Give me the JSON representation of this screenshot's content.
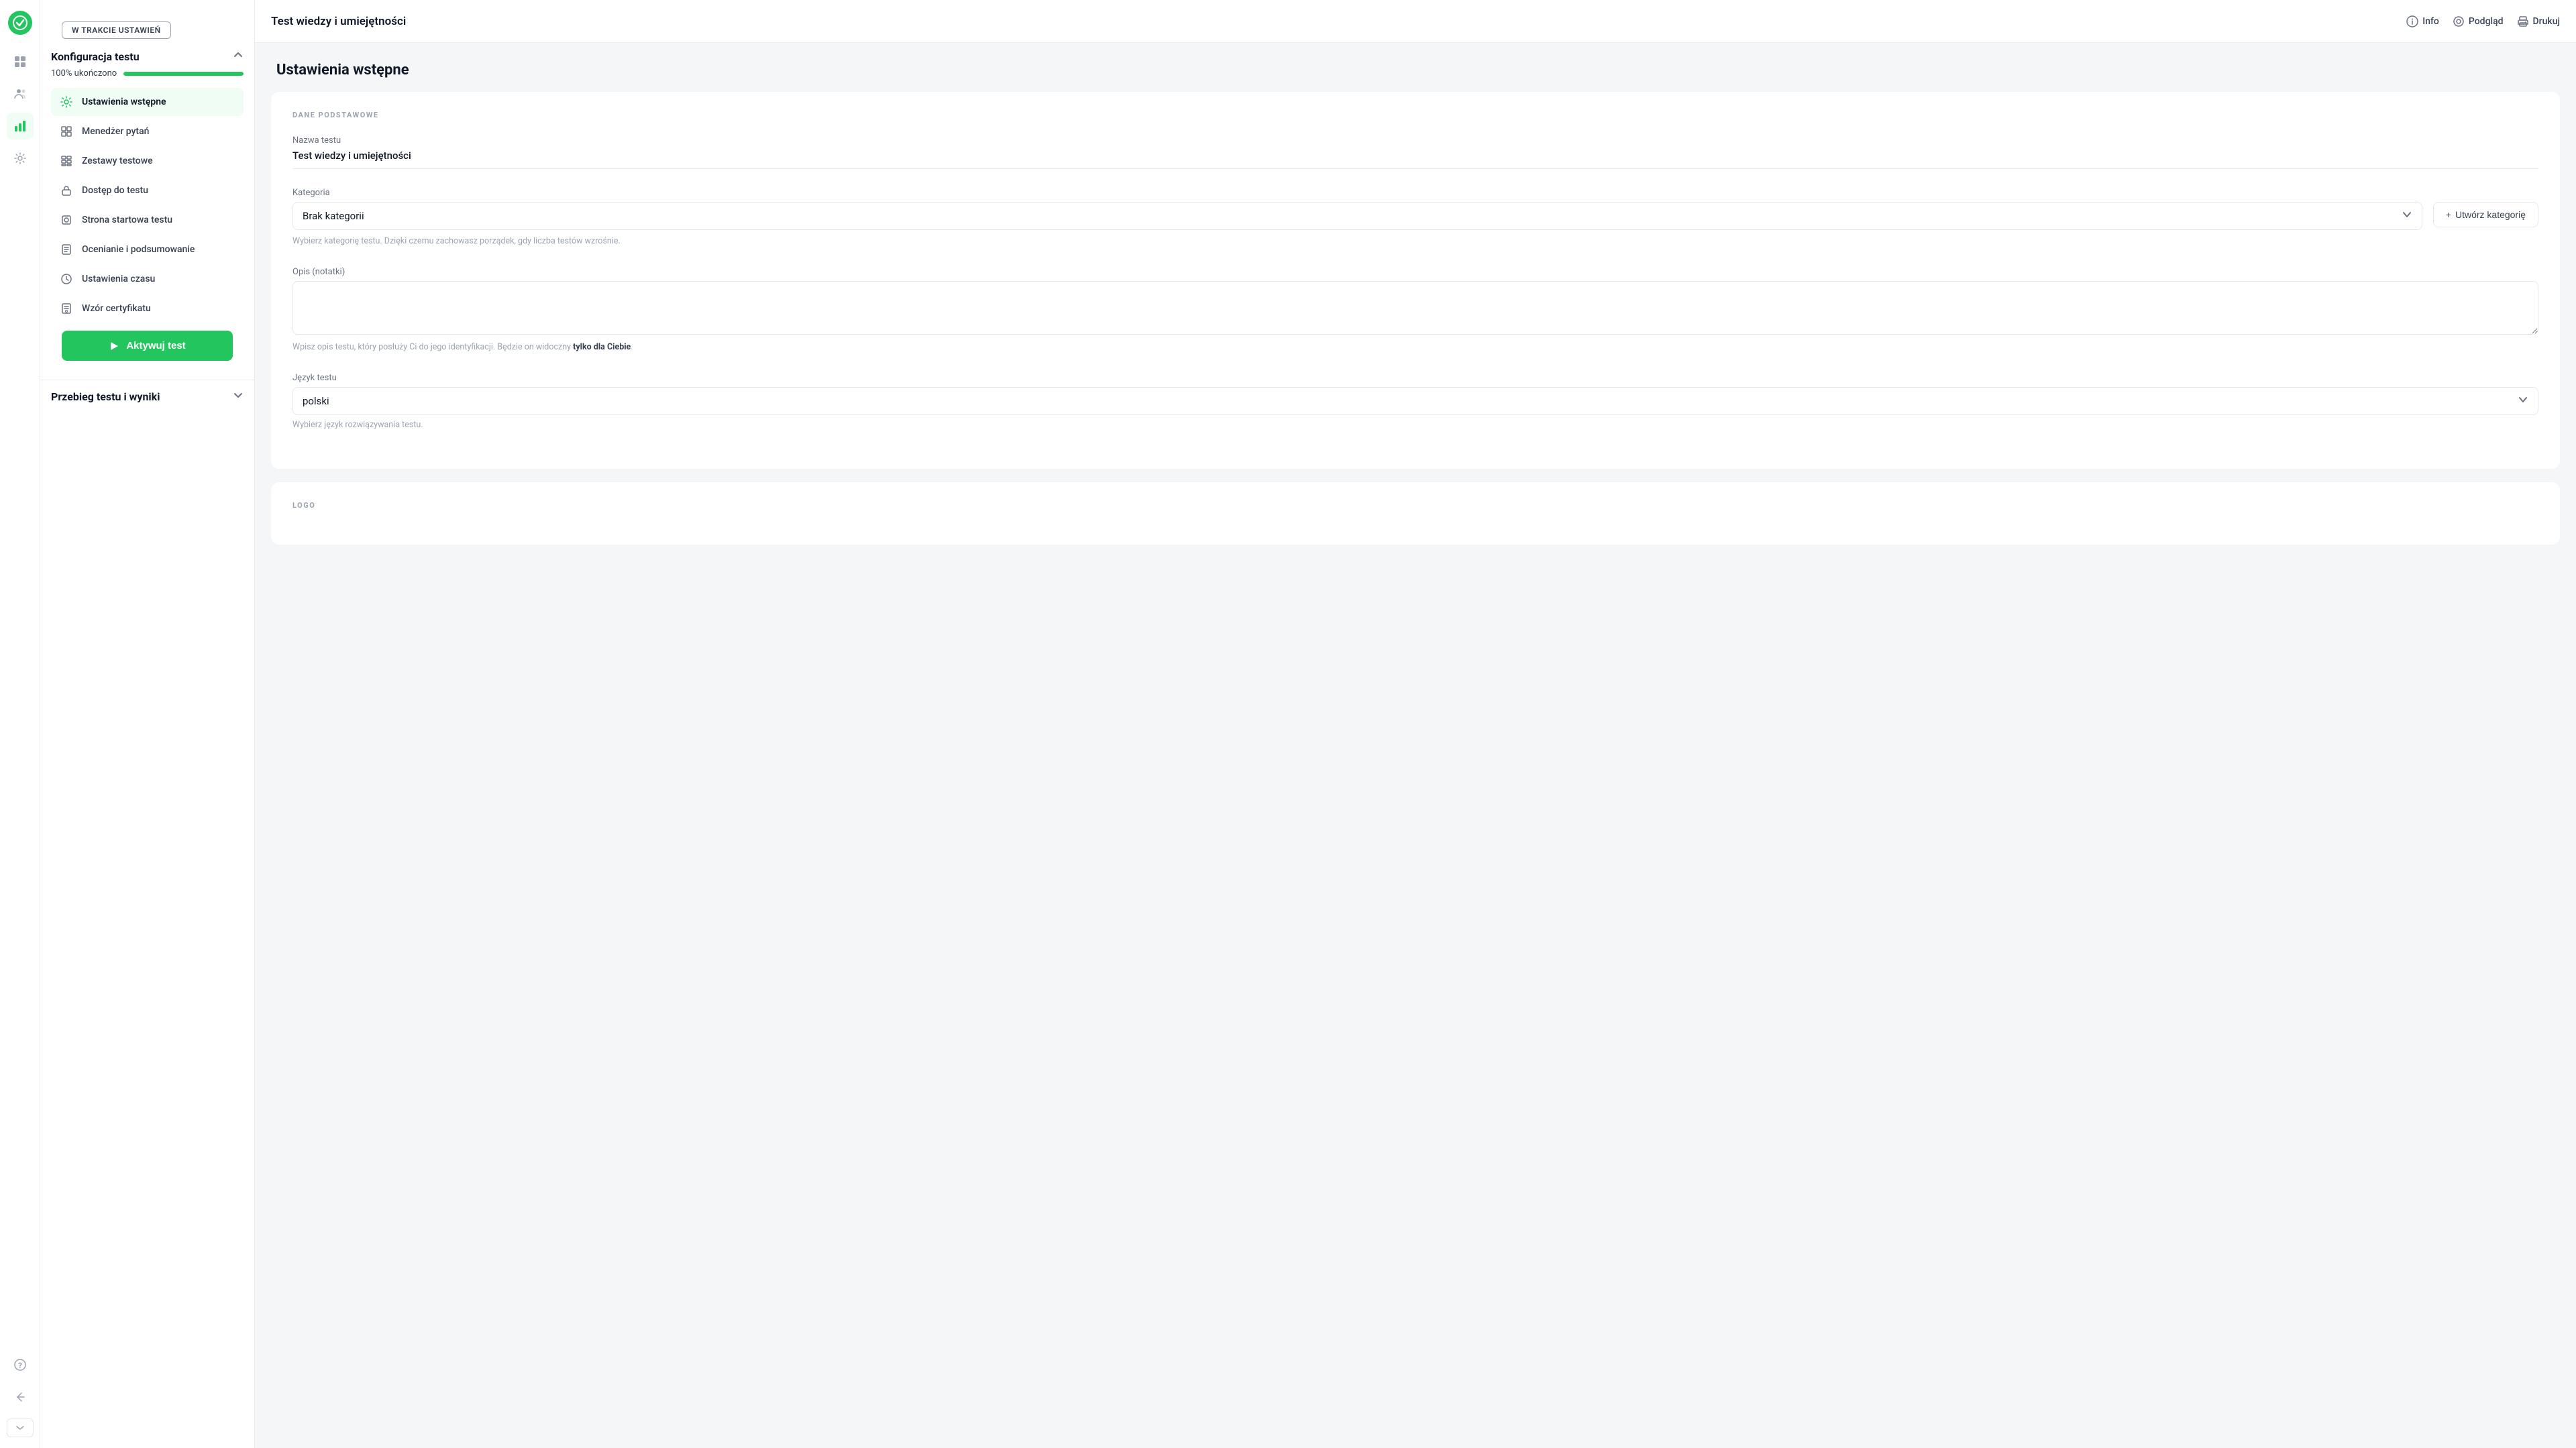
{
  "app": {
    "title": "Test wiedzy i umiejętności"
  },
  "topbar": {
    "title": "Test wiedzy i umiejętności",
    "info_label": "Info",
    "preview_label": "Podgląd",
    "print_label": "Drukuj"
  },
  "status": {
    "badge": "W TRAKCIE USTAWIEŃ"
  },
  "sidebar": {
    "config_title": "Konfiguracja testu",
    "progress_label": "100% ukończono",
    "progress_value": 100,
    "items": [
      {
        "id": "ustawienia-wstepne",
        "label": "Ustawienia wstępne",
        "icon": "⚙",
        "active": true
      },
      {
        "id": "menedzer-pytan",
        "label": "Menedżer pytań",
        "icon": "⊞",
        "active": false
      },
      {
        "id": "zestawy-testowe",
        "label": "Zestawy testowe",
        "icon": "▦",
        "active": false
      },
      {
        "id": "dostep-do-testu",
        "label": "Dostęp do testu",
        "icon": "🔒",
        "active": false
      },
      {
        "id": "strona-startowa",
        "label": "Strona startowa testu",
        "icon": "⬜",
        "active": false
      },
      {
        "id": "ocenianie",
        "label": "Ocenianie i podsumowanie",
        "icon": "📋",
        "active": false
      },
      {
        "id": "ustawienia-czasu",
        "label": "Ustawienia czasu",
        "icon": "🕐",
        "active": false
      },
      {
        "id": "wzor-certyfikatu",
        "label": "Wzór certyfikatu",
        "icon": "📜",
        "active": false
      }
    ],
    "activate_btn": "Aktywuj test",
    "results_title": "Przebieg testu i wyniki"
  },
  "icon_nav": {
    "logo_symbol": "✓",
    "items": [
      {
        "id": "dashboard",
        "icon": "⊞",
        "active": false
      },
      {
        "id": "users",
        "icon": "👥",
        "active": false
      },
      {
        "id": "analytics",
        "icon": "📊",
        "active": true
      },
      {
        "id": "settings",
        "icon": "⚙",
        "active": false
      }
    ],
    "bottom": [
      {
        "id": "help",
        "icon": "?"
      },
      {
        "id": "back",
        "icon": "↩"
      }
    ],
    "expand_label": ">>"
  },
  "main": {
    "page_title": "Ustawienia wstępne",
    "sections": [
      {
        "id": "dane-podstawowe",
        "section_label": "DANE PODSTAWOWE",
        "fields": [
          {
            "id": "nazwa-testu",
            "label": "Nazwa testu",
            "value": "Test wiedzy i umiejętności",
            "type": "text-display"
          },
          {
            "id": "kategoria",
            "label": "Kategoria",
            "value": "Brak kategorii",
            "type": "select",
            "hint": "Wybierz kategorię testu. Dzięki czemu zachowasz porządek, gdy liczba testów wzrośnie.",
            "create_btn": "+ Utwórz kategorię"
          },
          {
            "id": "opis",
            "label": "Opis (notatki)",
            "type": "textarea",
            "placeholder": "",
            "hint_before": "Wpisz opis testu, który posłuży Ci do jego identyfikacji. Będzie on widoczny ",
            "hint_bold": "tylko dla Ciebie",
            "hint_after": "."
          },
          {
            "id": "jezyk-testu",
            "label": "Język testu",
            "value": "polski",
            "type": "select",
            "hint": "Wybierz język rozwiązywania testu."
          }
        ]
      },
      {
        "id": "logo",
        "section_label": "LOGO"
      }
    ]
  }
}
